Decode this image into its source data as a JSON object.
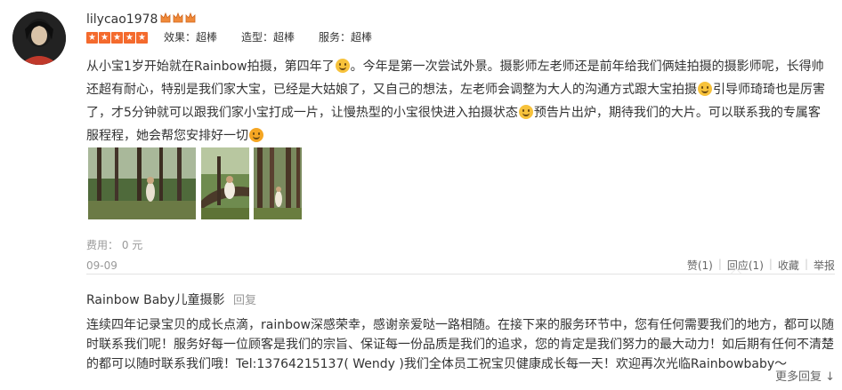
{
  "user": {
    "name": "lilycao1978",
    "crowns": 3,
    "star_count": 5
  },
  "ratings": [
    {
      "label": "效果：超棒"
    },
    {
      "label": "造型：超棒"
    },
    {
      "label": "服务：超棒"
    }
  ],
  "review": {
    "segments": [
      "从小宝1岁开始就在Rainbow拍摄，第四年了",
      "。今年是第一次尝试外景。摄影师左老师还是前年给我们俩娃拍摄的摄影师呢，长得帅还超有耐心，特别是我们家大宝，已经是大姑娘了，又自己的想法，左老师会调整为大人的沟通方式跟大宝拍摄",
      "引导师琦琦也是厉害了，才5分钟就可以跟我们家小宝打成一片，让慢热型的小宝很快进入拍摄状态",
      "预告片出炉，期待我们的大片。可以联系我的专属客服程程，她会帮您安排好一切"
    ]
  },
  "photos": [
    {
      "name": "forest-photo-1"
    },
    {
      "name": "forest-photo-2"
    },
    {
      "name": "forest-photo-3"
    }
  ],
  "fee": "费用： 0 元",
  "date": "09-09",
  "actions": {
    "like": "赞(1)",
    "reply": "回应(1)",
    "favorite": "收藏",
    "report": "举报"
  },
  "merchant_reply": {
    "author": "Rainbow Baby儿童摄影",
    "reply_label": "回复",
    "text": "连续四年记录宝贝的成长点滴，rainbow深感荣幸，感谢亲爱哒一路相随。在接下来的服务环节中，您有任何需要我们的地方，都可以随时联系我们呢！服务好每一位顾客是我们的宗旨、保证每一份品质是我们的追求，您的肯定是我们努力的最大动力！如后期有任何不清楚的都可以随时联系我们哦！Tel:13764215137( Wendy )我们全体员工祝宝贝健康成长每一天！欢迎再次光临Rainbowbaby～"
  },
  "more_replies": "更多回复 ↓",
  "colors": {
    "star": "#f46a2d",
    "crown": "#f08a3a",
    "emoji": "#f7c23b",
    "divider": "#e3e3e3"
  }
}
